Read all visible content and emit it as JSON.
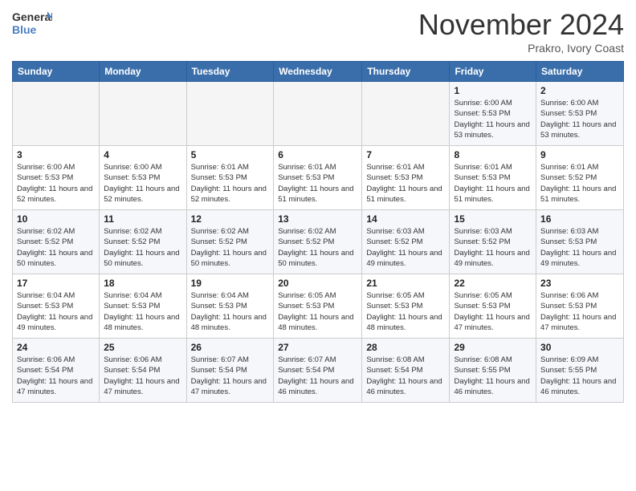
{
  "header": {
    "logo_general": "General",
    "logo_blue": "Blue",
    "month_title": "November 2024",
    "location": "Prakro, Ivory Coast"
  },
  "weekdays": [
    "Sunday",
    "Monday",
    "Tuesday",
    "Wednesday",
    "Thursday",
    "Friday",
    "Saturday"
  ],
  "weeks": [
    [
      {
        "day": "",
        "sunrise": "",
        "sunset": "",
        "daylight": "",
        "empty": true
      },
      {
        "day": "",
        "sunrise": "",
        "sunset": "",
        "daylight": "",
        "empty": true
      },
      {
        "day": "",
        "sunrise": "",
        "sunset": "",
        "daylight": "",
        "empty": true
      },
      {
        "day": "",
        "sunrise": "",
        "sunset": "",
        "daylight": "",
        "empty": true
      },
      {
        "day": "",
        "sunrise": "",
        "sunset": "",
        "daylight": "",
        "empty": true
      },
      {
        "day": "1",
        "sunrise": "Sunrise: 6:00 AM",
        "sunset": "Sunset: 5:53 PM",
        "daylight": "Daylight: 11 hours and 53 minutes.",
        "empty": false
      },
      {
        "day": "2",
        "sunrise": "Sunrise: 6:00 AM",
        "sunset": "Sunset: 5:53 PM",
        "daylight": "Daylight: 11 hours and 53 minutes.",
        "empty": false
      }
    ],
    [
      {
        "day": "3",
        "sunrise": "Sunrise: 6:00 AM",
        "sunset": "Sunset: 5:53 PM",
        "daylight": "Daylight: 11 hours and 52 minutes.",
        "empty": false
      },
      {
        "day": "4",
        "sunrise": "Sunrise: 6:00 AM",
        "sunset": "Sunset: 5:53 PM",
        "daylight": "Daylight: 11 hours and 52 minutes.",
        "empty": false
      },
      {
        "day": "5",
        "sunrise": "Sunrise: 6:01 AM",
        "sunset": "Sunset: 5:53 PM",
        "daylight": "Daylight: 11 hours and 52 minutes.",
        "empty": false
      },
      {
        "day": "6",
        "sunrise": "Sunrise: 6:01 AM",
        "sunset": "Sunset: 5:53 PM",
        "daylight": "Daylight: 11 hours and 51 minutes.",
        "empty": false
      },
      {
        "day": "7",
        "sunrise": "Sunrise: 6:01 AM",
        "sunset": "Sunset: 5:53 PM",
        "daylight": "Daylight: 11 hours and 51 minutes.",
        "empty": false
      },
      {
        "day": "8",
        "sunrise": "Sunrise: 6:01 AM",
        "sunset": "Sunset: 5:53 PM",
        "daylight": "Daylight: 11 hours and 51 minutes.",
        "empty": false
      },
      {
        "day": "9",
        "sunrise": "Sunrise: 6:01 AM",
        "sunset": "Sunset: 5:52 PM",
        "daylight": "Daylight: 11 hours and 51 minutes.",
        "empty": false
      }
    ],
    [
      {
        "day": "10",
        "sunrise": "Sunrise: 6:02 AM",
        "sunset": "Sunset: 5:52 PM",
        "daylight": "Daylight: 11 hours and 50 minutes.",
        "empty": false
      },
      {
        "day": "11",
        "sunrise": "Sunrise: 6:02 AM",
        "sunset": "Sunset: 5:52 PM",
        "daylight": "Daylight: 11 hours and 50 minutes.",
        "empty": false
      },
      {
        "day": "12",
        "sunrise": "Sunrise: 6:02 AM",
        "sunset": "Sunset: 5:52 PM",
        "daylight": "Daylight: 11 hours and 50 minutes.",
        "empty": false
      },
      {
        "day": "13",
        "sunrise": "Sunrise: 6:02 AM",
        "sunset": "Sunset: 5:52 PM",
        "daylight": "Daylight: 11 hours and 50 minutes.",
        "empty": false
      },
      {
        "day": "14",
        "sunrise": "Sunrise: 6:03 AM",
        "sunset": "Sunset: 5:52 PM",
        "daylight": "Daylight: 11 hours and 49 minutes.",
        "empty": false
      },
      {
        "day": "15",
        "sunrise": "Sunrise: 6:03 AM",
        "sunset": "Sunset: 5:52 PM",
        "daylight": "Daylight: 11 hours and 49 minutes.",
        "empty": false
      },
      {
        "day": "16",
        "sunrise": "Sunrise: 6:03 AM",
        "sunset": "Sunset: 5:53 PM",
        "daylight": "Daylight: 11 hours and 49 minutes.",
        "empty": false
      }
    ],
    [
      {
        "day": "17",
        "sunrise": "Sunrise: 6:04 AM",
        "sunset": "Sunset: 5:53 PM",
        "daylight": "Daylight: 11 hours and 49 minutes.",
        "empty": false
      },
      {
        "day": "18",
        "sunrise": "Sunrise: 6:04 AM",
        "sunset": "Sunset: 5:53 PM",
        "daylight": "Daylight: 11 hours and 48 minutes.",
        "empty": false
      },
      {
        "day": "19",
        "sunrise": "Sunrise: 6:04 AM",
        "sunset": "Sunset: 5:53 PM",
        "daylight": "Daylight: 11 hours and 48 minutes.",
        "empty": false
      },
      {
        "day": "20",
        "sunrise": "Sunrise: 6:05 AM",
        "sunset": "Sunset: 5:53 PM",
        "daylight": "Daylight: 11 hours and 48 minutes.",
        "empty": false
      },
      {
        "day": "21",
        "sunrise": "Sunrise: 6:05 AM",
        "sunset": "Sunset: 5:53 PM",
        "daylight": "Daylight: 11 hours and 48 minutes.",
        "empty": false
      },
      {
        "day": "22",
        "sunrise": "Sunrise: 6:05 AM",
        "sunset": "Sunset: 5:53 PM",
        "daylight": "Daylight: 11 hours and 47 minutes.",
        "empty": false
      },
      {
        "day": "23",
        "sunrise": "Sunrise: 6:06 AM",
        "sunset": "Sunset: 5:53 PM",
        "daylight": "Daylight: 11 hours and 47 minutes.",
        "empty": false
      }
    ],
    [
      {
        "day": "24",
        "sunrise": "Sunrise: 6:06 AM",
        "sunset": "Sunset: 5:54 PM",
        "daylight": "Daylight: 11 hours and 47 minutes.",
        "empty": false
      },
      {
        "day": "25",
        "sunrise": "Sunrise: 6:06 AM",
        "sunset": "Sunset: 5:54 PM",
        "daylight": "Daylight: 11 hours and 47 minutes.",
        "empty": false
      },
      {
        "day": "26",
        "sunrise": "Sunrise: 6:07 AM",
        "sunset": "Sunset: 5:54 PM",
        "daylight": "Daylight: 11 hours and 47 minutes.",
        "empty": false
      },
      {
        "day": "27",
        "sunrise": "Sunrise: 6:07 AM",
        "sunset": "Sunset: 5:54 PM",
        "daylight": "Daylight: 11 hours and 46 minutes.",
        "empty": false
      },
      {
        "day": "28",
        "sunrise": "Sunrise: 6:08 AM",
        "sunset": "Sunset: 5:54 PM",
        "daylight": "Daylight: 11 hours and 46 minutes.",
        "empty": false
      },
      {
        "day": "29",
        "sunrise": "Sunrise: 6:08 AM",
        "sunset": "Sunset: 5:55 PM",
        "daylight": "Daylight: 11 hours and 46 minutes.",
        "empty": false
      },
      {
        "day": "30",
        "sunrise": "Sunrise: 6:09 AM",
        "sunset": "Sunset: 5:55 PM",
        "daylight": "Daylight: 11 hours and 46 minutes.",
        "empty": false
      }
    ]
  ]
}
